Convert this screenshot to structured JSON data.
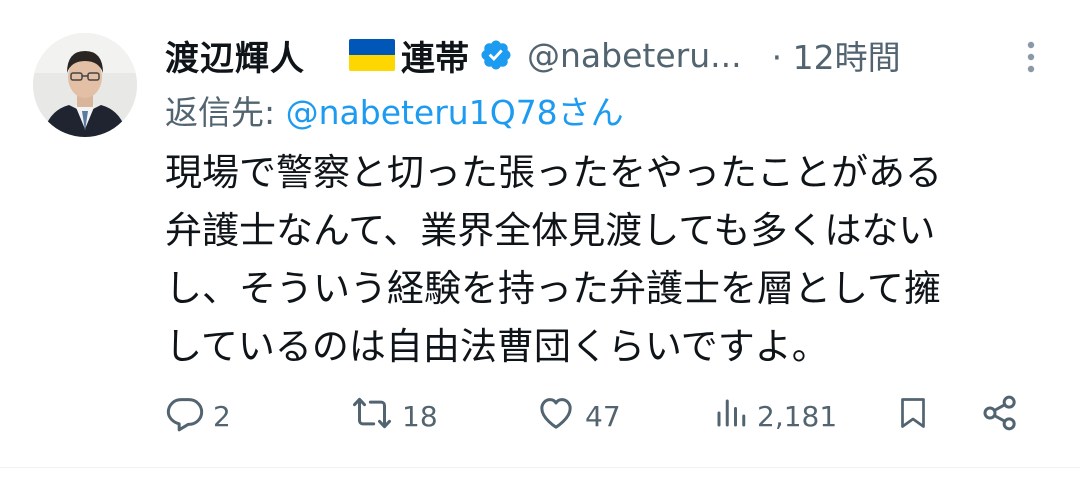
{
  "author": {
    "name": "渡辺輝人",
    "name_suffix": "連帯",
    "handle": "@nabeteru...",
    "time": "· 12時間"
  },
  "reply": {
    "prefix": "返信先: ",
    "mention": "@nabeteru1Q78さん"
  },
  "body": {
    "lines": [
      "現場で警察と切った張ったをやったことがある",
      "弁護士なんて、業界全体見渡しても多くはない",
      "し、そういう経験を持った弁護士を層として擁",
      "しているのは自由法曹団くらいですよ。"
    ]
  },
  "actions": {
    "replies": "2",
    "retweets": "18",
    "likes": "47",
    "views": "2,181"
  },
  "colors": {
    "text": "#0f1419",
    "secondary": "#536471",
    "accent": "#1d9bf0",
    "flag_blue": "#0057b7",
    "flag_yellow": "#ffd700"
  },
  "icons": [
    "avatar",
    "ukraine-flag-icon",
    "verified-badge-icon",
    "more-icon",
    "reply-icon",
    "retweet-icon",
    "like-icon",
    "views-icon",
    "bookmark-icon",
    "share-icon"
  ]
}
